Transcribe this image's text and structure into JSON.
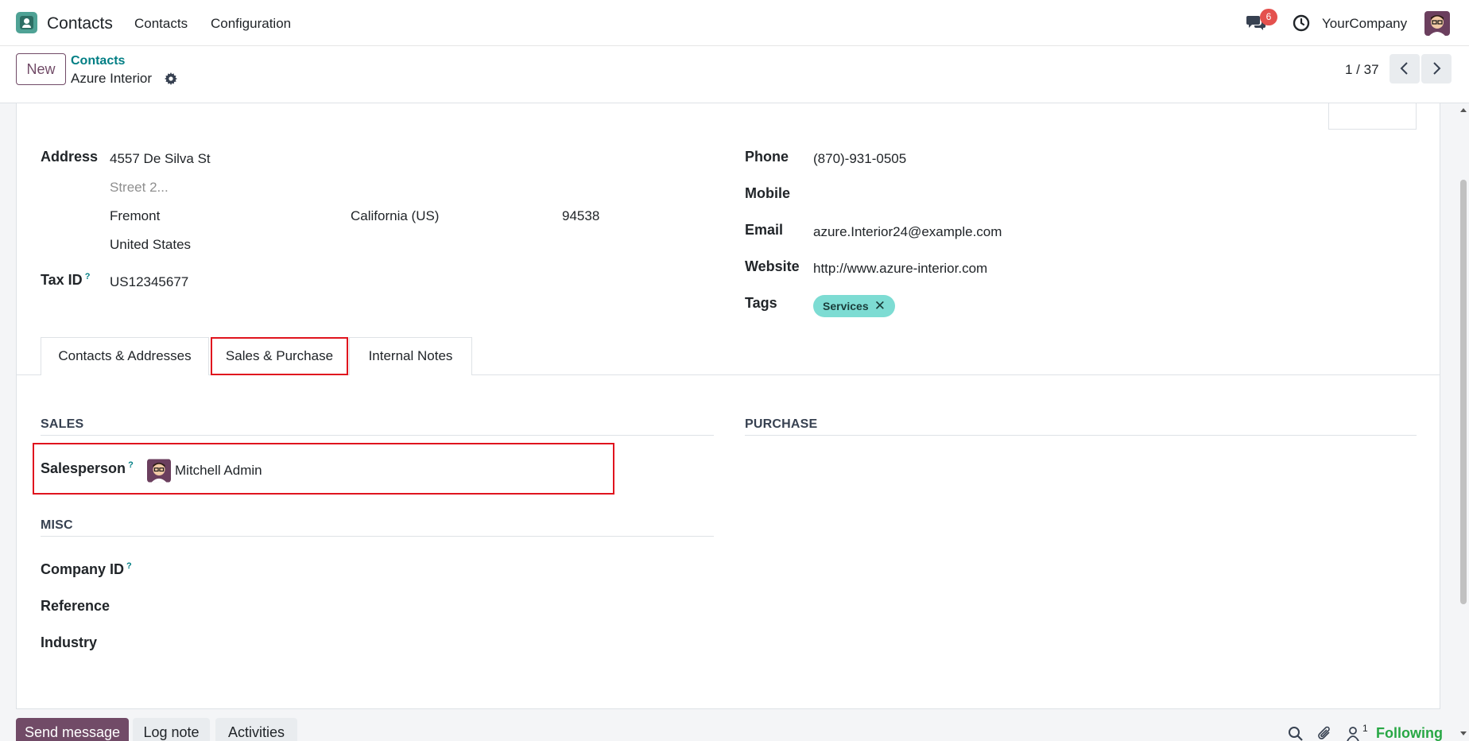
{
  "navbar": {
    "app_name": "Contacts",
    "menu": [
      "Contacts",
      "Configuration"
    ],
    "chat_badge": "6",
    "company": "YourCompany"
  },
  "control_panel": {
    "new_label": "New",
    "breadcrumb_parent": "Contacts",
    "breadcrumb_current": "Azure Interior",
    "pager": "1 / 37"
  },
  "form": {
    "address_label": "Address",
    "street": "4557 De Silva St",
    "street2_placeholder": "Street 2...",
    "city": "Fremont",
    "state": "California (US)",
    "zip": "94538",
    "country": "United States",
    "tax_id_label": "Tax ID",
    "tax_id_help": "?",
    "tax_id": "US12345677",
    "phone_label": "Phone",
    "phone": "(870)-931-0505",
    "mobile_label": "Mobile",
    "email_label": "Email",
    "email": "azure.Interior24@example.com",
    "website_label": "Website",
    "website": "http://www.azure-interior.com",
    "tags_label": "Tags",
    "tag": "Services",
    "tag_remove": "✕"
  },
  "tabs": [
    {
      "label": "Contacts & Addresses",
      "active": false
    },
    {
      "label": "Sales & Purchase",
      "active": true
    },
    {
      "label": "Internal Notes",
      "active": false
    }
  ],
  "sales": {
    "title": "SALES",
    "salesperson_label": "Salesperson",
    "salesperson_help": "?",
    "salesperson": "Mitchell Admin"
  },
  "purchase": {
    "title": "PURCHASE"
  },
  "misc": {
    "title": "MISC",
    "company_id_label": "Company ID",
    "company_id_help": "?",
    "reference_label": "Reference",
    "industry_label": "Industry"
  },
  "chatter": {
    "send_message": "Send message",
    "log_note": "Log note",
    "activities": "Activities",
    "follower_count": "1",
    "following": "Following"
  },
  "colors": {
    "brand": "#714b67",
    "link": "#017e84",
    "highlight": "#e0141e",
    "tag_bg": "#7ddcd3",
    "following": "#28a745"
  }
}
